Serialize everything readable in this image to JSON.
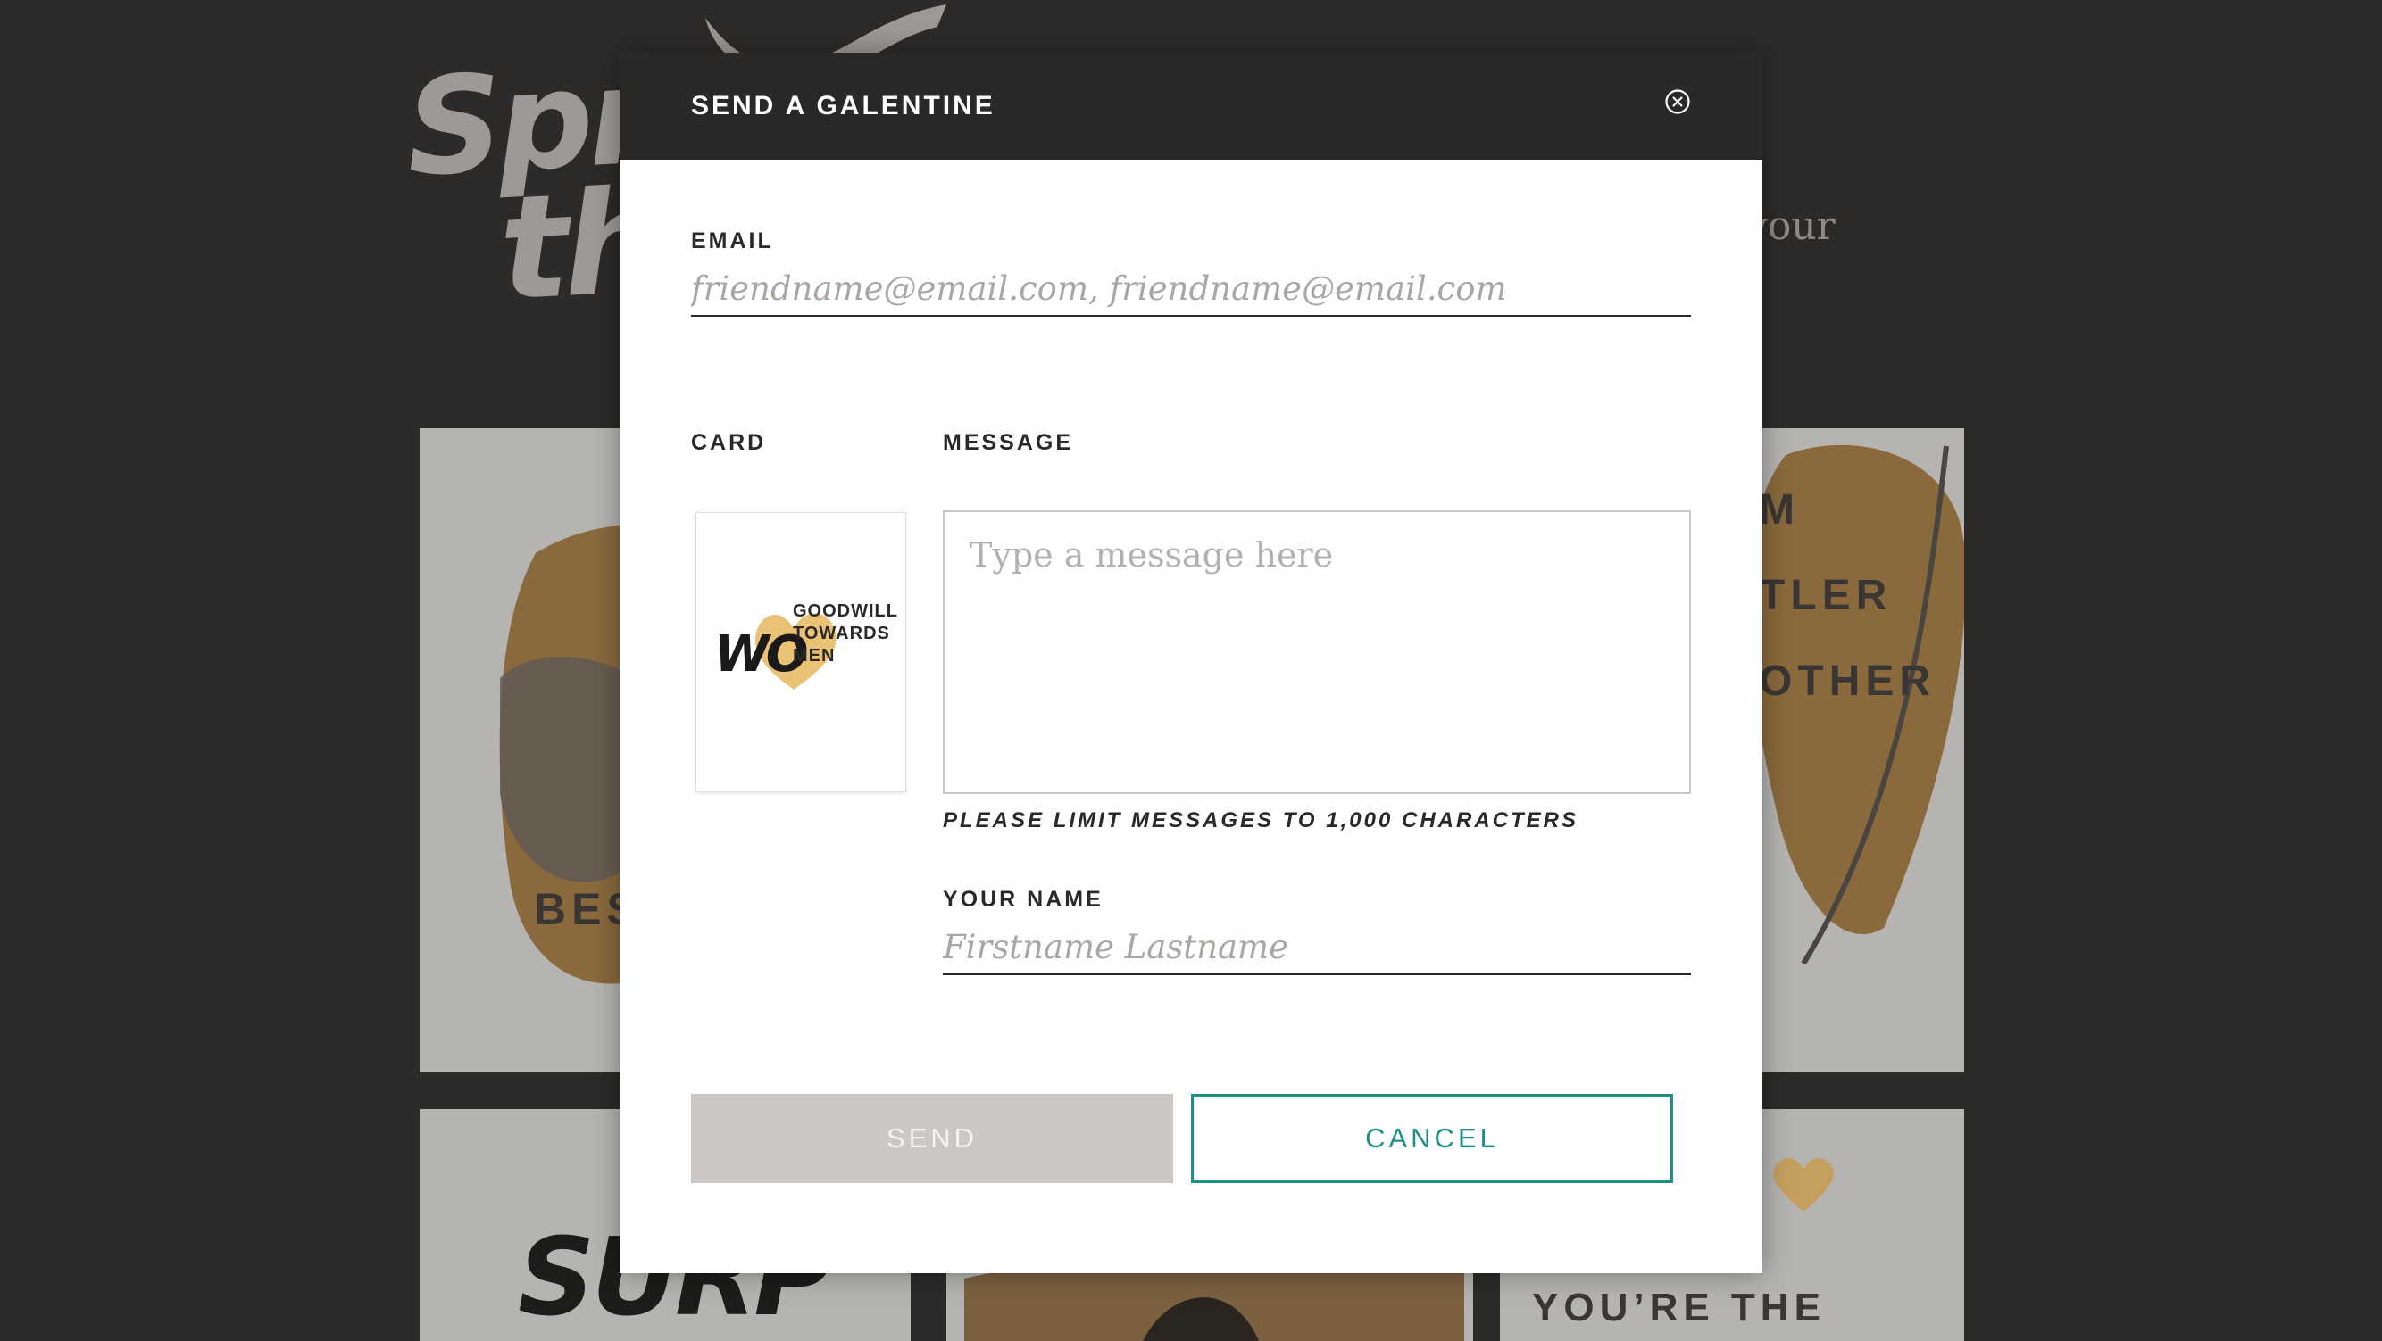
{
  "background": {
    "headline_line1": "Spre",
    "headline_line2": "th",
    "side_text": "your",
    "card_top_right_lines": [
      "M",
      "TLER",
      "OTHER"
    ],
    "card_left_text": "BES",
    "card_bottom_left_text": "SURP",
    "card_bottom_right_text": "YOU’RE THE"
  },
  "modal": {
    "title": "SEND A GALENTINE",
    "close_icon": "close-circle-icon",
    "email": {
      "label": "EMAIL",
      "value": "",
      "placeholder": "friendname@email.com, friendname@email.com"
    },
    "card": {
      "label": "CARD",
      "logo_lines": [
        "GOODWILL",
        "TOWARDS",
        "MEN"
      ],
      "logo_prefix": "WO"
    },
    "message": {
      "label": "MESSAGE",
      "value": "",
      "placeholder": "Type a message here",
      "hint": "PLEASE LIMIT MESSAGES TO 1,000 CHARACTERS"
    },
    "your_name": {
      "label": "YOUR NAME",
      "value": "",
      "placeholder": "Firstname Lastname"
    },
    "buttons": {
      "send": "SEND",
      "cancel": "CANCEL"
    }
  },
  "colors": {
    "page_bg": "#2d2b29",
    "header_bg": "#2b2927",
    "accent_teal": "#1f8f86",
    "send_disabled": "#cac7c4",
    "gold": "#c99a48"
  }
}
